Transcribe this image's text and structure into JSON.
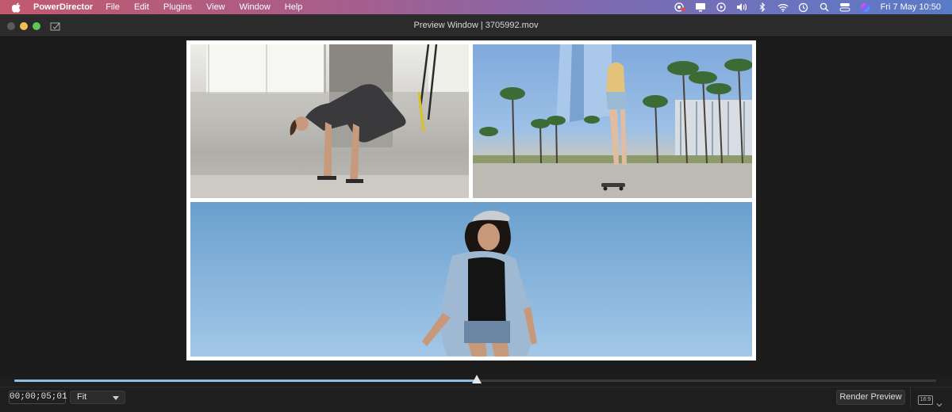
{
  "menubar": {
    "app_name": "PowerDirector",
    "items": [
      "File",
      "Edit",
      "Plugins",
      "View",
      "Window",
      "Help"
    ],
    "clock": "Fri 7 May  10:50"
  },
  "window": {
    "title": "Preview Window | 3705992.mov"
  },
  "preview": {
    "tiles": [
      "woman-exercising-photo",
      "woman-skateboarding-photo",
      "woman-smiling-sky-photo"
    ]
  },
  "timeline": {
    "progress": 0.502
  },
  "controls": {
    "timecode": "00;00;05;01",
    "zoom_select": "Fit",
    "render_button": "Render Preview",
    "aspect_ratio": "16:9"
  },
  "colors": {
    "menubar_gradient_start": "#c25a6e",
    "menubar_gradient_end": "#5a7bc7",
    "scrub_fill": "#8fbfe6",
    "window_bg": "#1e1e1e"
  }
}
